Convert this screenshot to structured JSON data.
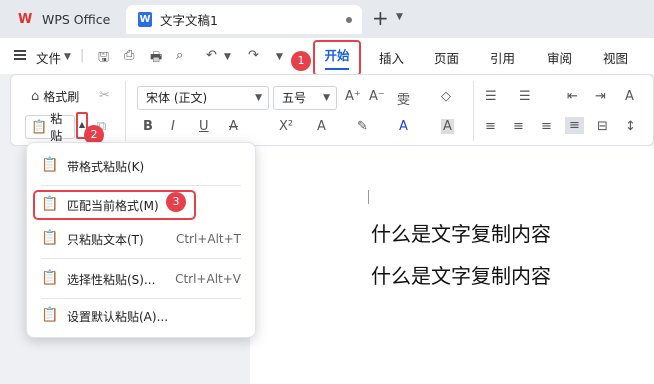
{
  "tabs": {
    "app_tab": "WPS Office",
    "doc_tab": "文字文稿1",
    "doc_icon_letter": "W"
  },
  "menubar": {
    "file_label": "文件",
    "ribbon_tabs": [
      "开始",
      "插入",
      "页面",
      "引用",
      "审阅",
      "视图"
    ],
    "active_tab": "开始"
  },
  "ribbon": {
    "format_painter": "格式刷",
    "paste": "粘贴",
    "font_name": "宋体 (正文)",
    "font_size": "五号"
  },
  "paste_menu": {
    "items": [
      {
        "label": "带格式粘贴(K)",
        "shortcut": "",
        "icon": "paste-format-icon"
      },
      {
        "label": "匹配当前格式(M)",
        "shortcut": "",
        "icon": "paste-match-icon"
      },
      {
        "label": "只粘贴文本(T)",
        "shortcut": "Ctrl+Alt+T",
        "icon": "paste-text-icon"
      },
      {
        "label": "选择性粘贴(S)...",
        "shortcut": "Ctrl+Alt+V",
        "icon": "paste-special-icon"
      },
      {
        "label": "设置默认粘贴(A)...",
        "shortcut": "",
        "icon": "paste-settings-icon"
      }
    ]
  },
  "document": {
    "lines": [
      "什么是文字复制内容",
      "什么是文字复制内容"
    ]
  },
  "badges": [
    "1",
    "2",
    "3"
  ],
  "colors": {
    "accent": "#1a5fe0",
    "highlight": "#e8404b",
    "wps_red": "#e5322d"
  }
}
